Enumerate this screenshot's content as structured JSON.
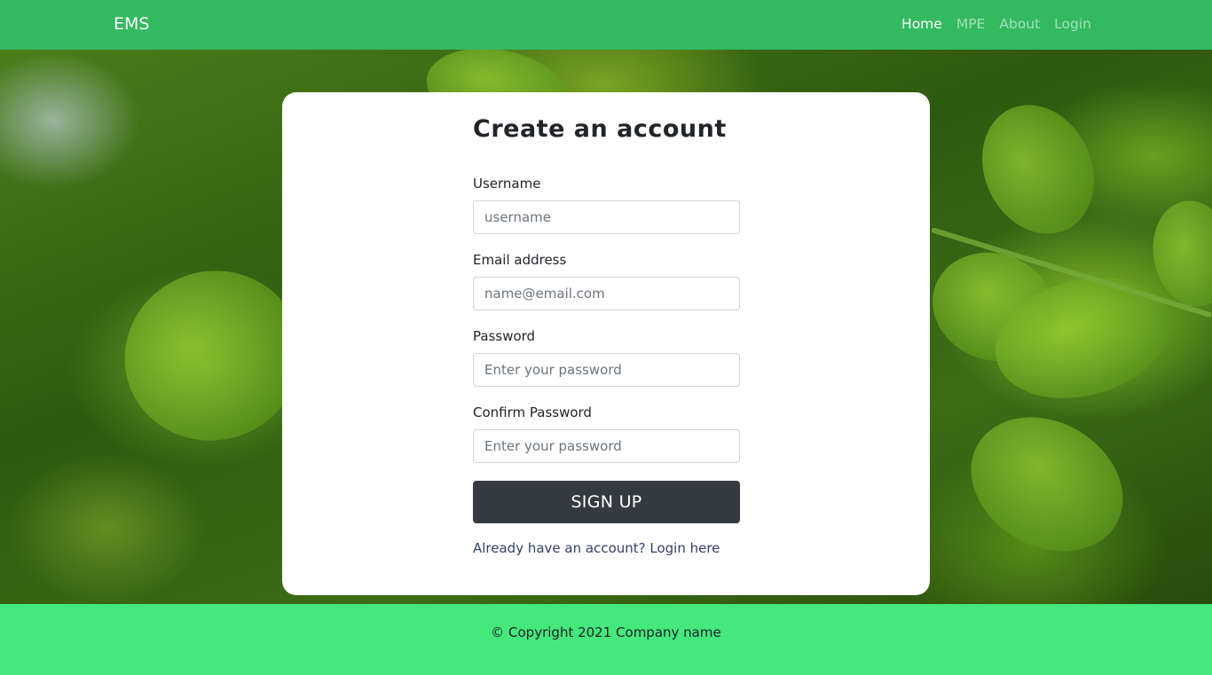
{
  "navbar": {
    "brand": "EMS",
    "links": [
      {
        "label": "Home",
        "active": true
      },
      {
        "label": "MPE",
        "active": false
      },
      {
        "label": "About",
        "active": false
      },
      {
        "label": "Login",
        "active": false
      }
    ]
  },
  "form": {
    "title": "Create an account",
    "fields": [
      {
        "label": "Username",
        "placeholder": "username",
        "value": ""
      },
      {
        "label": "Email address",
        "placeholder": "name@email.com",
        "value": ""
      },
      {
        "label": "Password",
        "placeholder": "Enter your password",
        "value": ""
      },
      {
        "label": "Confirm Password",
        "placeholder": "Enter your password",
        "value": ""
      }
    ],
    "submit_label": "SIGN UP",
    "login_link": "Already have an account? Login here"
  },
  "footer": {
    "text": "© Copyright 2021 Company name"
  },
  "colors": {
    "navbar": "#33b960",
    "footer": "#45e87c",
    "button": "#343a40"
  }
}
